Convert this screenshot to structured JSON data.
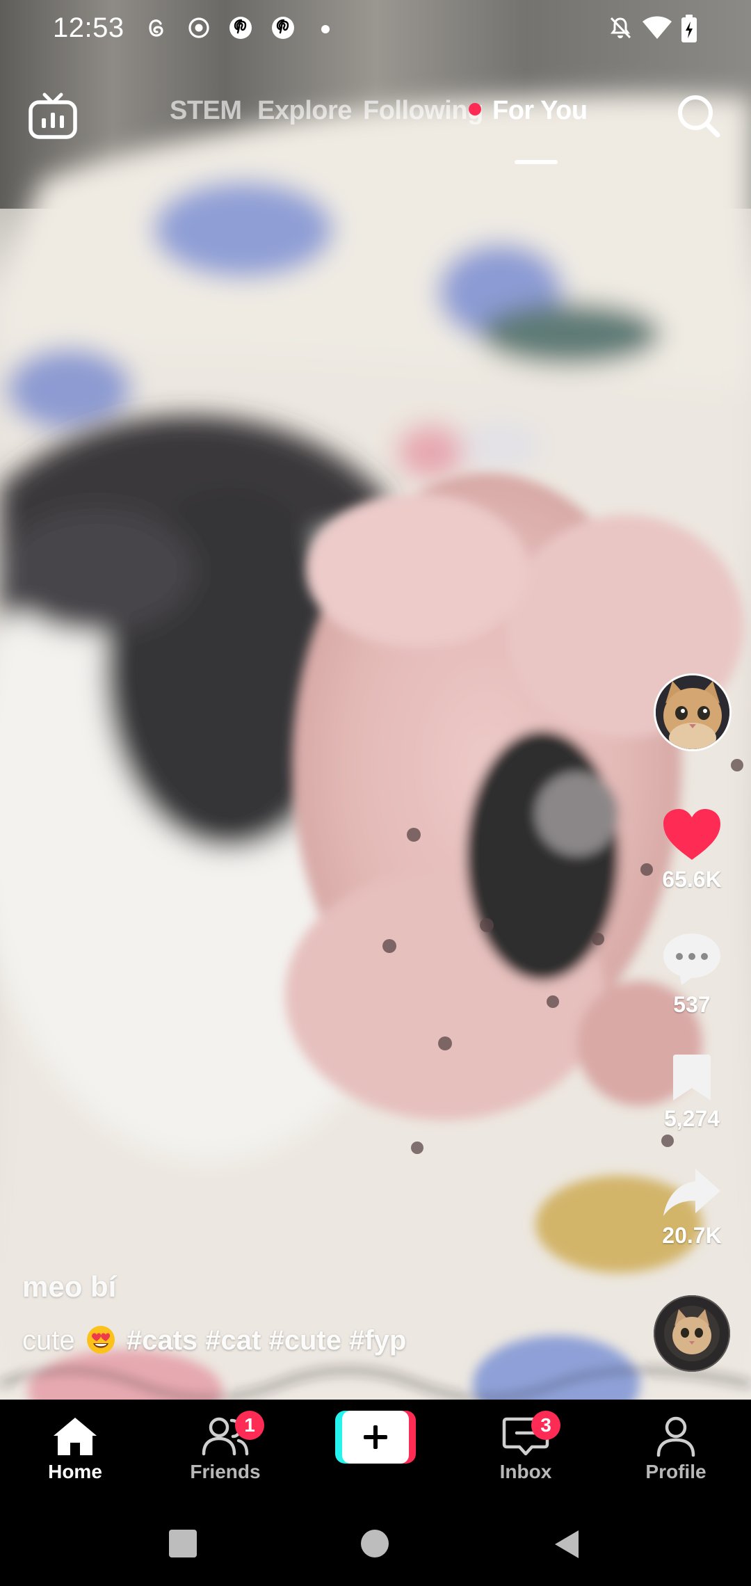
{
  "status_bar": {
    "time": "12:53",
    "left_icons": [
      "threads-icon",
      "record-icon",
      "pinterest-icon",
      "pinterest-icon",
      "dot-icon"
    ],
    "right_icons": [
      "mute-icon",
      "wifi-icon",
      "battery-charging-icon"
    ]
  },
  "top_nav": {
    "tabs": [
      {
        "label": "STEM",
        "active": false
      },
      {
        "label": "Explore",
        "active": false
      },
      {
        "label": "Following",
        "active": false,
        "has_dot": true
      },
      {
        "label": "For You",
        "active": true
      }
    ],
    "left_icon": "live-tv-icon",
    "right_icon": "search-icon"
  },
  "actions": {
    "likes": "65.6K",
    "comments": "537",
    "bookmarks": "5,274",
    "shares": "20.7K"
  },
  "post": {
    "username": "meo bí",
    "description_prefix": "cute",
    "emoji": "heart-eyes-emoji",
    "hashtags": [
      "#cats",
      "#cat",
      "#cute",
      "#fyp"
    ]
  },
  "bottom_bar": {
    "home": "Home",
    "friends": "Friends",
    "friends_badge": "1",
    "inbox": "Inbox",
    "inbox_badge": "3",
    "profile": "Profile"
  },
  "colors": {
    "accent": "#fe2c55",
    "cyan": "#25f4ee",
    "background": "#000000"
  }
}
